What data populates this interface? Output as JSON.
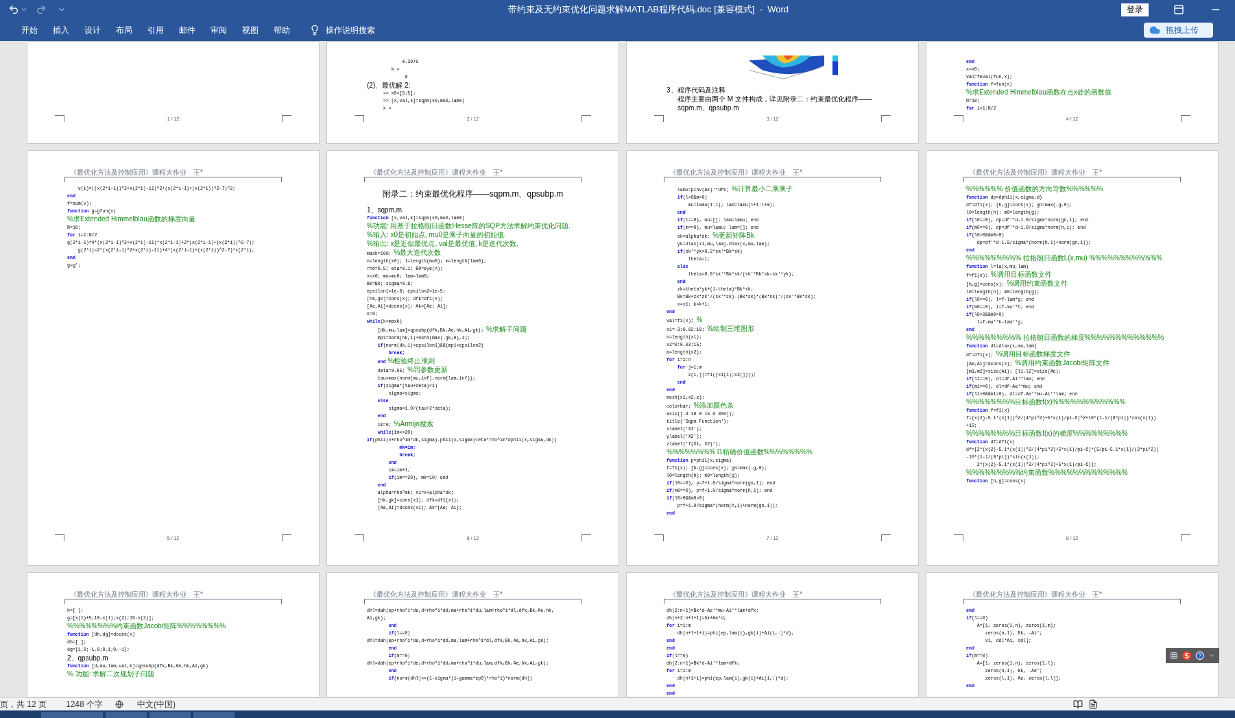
{
  "window": {
    "title": "带约束及无约束优化问题求解MATLAB程序代码.doc [兼容模式]  -  Word",
    "sign_in": "登录"
  },
  "ribbon": {
    "tabs": [
      "开始",
      "插入",
      "设计",
      "布局",
      "引用",
      "邮件",
      "审阅",
      "视图",
      "帮助"
    ],
    "search": "操作说明搜索",
    "upload_button": "拖拽上传"
  },
  "pages": [
    {
      "page_number": "1 / 12"
    },
    {
      "page_number": "2 / 12",
      "lines": [
        {
          "text": "             0.3979"
        },
        {
          "text": "         k ="
        },
        {
          "text": "              8"
        },
        {
          "kind": "heading",
          "text": "(2)、最优解 2:"
        },
        {
          "text": "      >> x0=[5;5];"
        },
        {
          "text": "      >> [x,val,k]=sqpm(x0,mu0,lam0)"
        },
        {
          "text": "      x ="
        }
      ]
    },
    {
      "page_number": "3 / 12",
      "lines": [
        {
          "kind": "heading",
          "text": "3、程序代码及注释"
        },
        {
          "kind": "paragraph",
          "text": "程序主要由两个 M 文件构成，详见附录二：约束最优化程序——sqpm.m、qpsubp.m"
        }
      ]
    },
    {
      "page_number": "4 / 12",
      "lines": [
        {
          "keyword": "end"
        },
        {
          "text": "x=x0;"
        },
        {
          "text": "val=feval(fun,x);"
        },
        {
          "keyword": "function",
          "text": " f=fun(x)"
        },
        {
          "comment": "%求Extended Himmelblau函数在点x处的函数值"
        },
        {
          "text": "N=10;"
        },
        {
          "keyword": "for",
          "text": " i=1:N/2"
        }
      ]
    },
    {
      "header": "《最优化方法及控制应用》课程大作业　王*",
      "page_number": "5 / 12",
      "lines": [
        {
          "text": "    v(i)=((x(2*i-1))^2+x(2*i)-11)^2+(x(2*i-1)+(x(2*i))^2-7)^2;"
        },
        {
          "keyword": "end"
        },
        {
          "text": "f=sum(v);"
        },
        {
          "keyword": "function",
          "text": " g=gfun(x)"
        },
        {
          "comment": "%求Extended Himmelblau函数的梯度向量"
        },
        {
          "text": "N=10;"
        },
        {
          "keyword": "for",
          "text": " i=1:N/2"
        },
        {
          "text": "g(2*i-1)=4*(x(2*i-1)^2+x(2*i)-11)*x(2*i-1)+2*(x(2*i-1)+(x(2*i))^2-7);"
        },
        {
          "text": "    g(2*i)=2*(x(2*i-1)^2+x(2*i)-11)+4*(x(2*i-1)+(x(2*i))^2-7)*x(2*i);"
        },
        {
          "keyword": "end"
        },
        {
          "text": "g=g';"
        }
      ]
    },
    {
      "header": "《最优化方法及控制应用》课程大作业　王*",
      "title": "附录二：约束最优化程序——sqpm.m、qpsubp.m",
      "page_number": "6 / 12",
      "lines": [
        {
          "kind": "heading",
          "text": "1、sqpm.m"
        },
        {
          "keyword": "function",
          "text": " [x,val,k]=sqpm(x0,mu0,lam0)"
        },
        {
          "comment": "%功能: 用基于拉格朗日函数Hesse阵的SQP方法求解约束优化问题."
        },
        {
          "comment": "%输入: x0是初始点, mu0是乘子向量的初始值."
        },
        {
          "comment": "%输出: x是近似最优点, val是最优值, k是迭代次数."
        },
        {
          "text": "maxk=100; ",
          "comment": "%最大迭代次数"
        },
        {
          "text": "n=length(x0); l=length(mu0); m=length(lam0);"
        },
        {
          "text": "rho=0.5; eta=0.1; B0=eye(n);"
        },
        {
          "text": "x=x0; mu=mu0; lam=lam0;"
        },
        {
          "text": "Bk=B0; sigma=0.8;"
        },
        {
          "text": "epsilon1=1e-6; epsilon2=1e-5;"
        },
        {
          "text": "[hk,gk]=cons(x); dfk=df1(x);"
        },
        {
          "text": "[Ae,Ai]=dcons(x); Ak=[Ae; Ai];"
        },
        {
          "text": "k=0;"
        },
        {
          "keyword": "while",
          "text": "(k<maxk)"
        },
        {
          "text": "    [dk,mu,lam]=qpsubp(dfk,Bk,Ae,hk,Ai,gk); ",
          "comment": "%求解子问题"
        },
        {
          "text": "    mp1=norm(hk,1)+norm(max(-gk,0),1);"
        },
        {
          "keyword": "    if",
          "text": "(norm(dk,1)<epsilon1)&&(mp1<epsilon2)"
        },
        {
          "keyword": "        break;"
        },
        {
          "keyword": "    end",
          "comment": " %检验终止准则"
        },
        {
          "text": "    deta=0.05; ",
          "comment": "%罚参数更新"
        },
        {
          "text": "    tau=max(norm(mu,inf),norm(lam,inf));"
        },
        {
          "keyword": "    if",
          "text": "(sigma*(tau+deta)<1)"
        },
        {
          "text": "        sigma=sigma;"
        },
        {
          "keyword": "    else"
        },
        {
          "text": "        sigma=1.0/(tau+2*deta);"
        },
        {
          "keyword": "    end"
        },
        {
          "text": "    im=0; ",
          "comment": "%Armijo搜索"
        },
        {
          "keyword": "    while",
          "text": "(im<=20)"
        },
        {
          "keyword": "if",
          "text": "(phi1(x+rho^im*dk,sigma)-phi1(x,sigma)<eta*rho^im*dphi1(x,sigma,dk))"
        },
        {
          "keyword": "            mk=im;"
        },
        {
          "keyword": "            break;"
        },
        {
          "keyword": "        end"
        },
        {
          "text": "        im=im+1;"
        },
        {
          "keyword": "        if",
          "text": "(im==20), mk=10; end"
        },
        {
          "keyword": "    end"
        },
        {
          "text": "    alpha=rho^mk; x1=x+alpha*dk;"
        },
        {
          "text": "    [hk,gk]=cons(x1); dfk=df1(x1);"
        },
        {
          "text": "    [Ae,Ai]=dcons(x1); Ak=[Ae; Ai];"
        }
      ]
    },
    {
      "header": "《最优化方法及控制应用》课程大作业　王*",
      "page_number": "7 / 12",
      "lines": [
        {
          "text": "    lamu=pinv(Ak)'*dfk; ",
          "comment": "%计算最小二乘乘子"
        },
        {
          "keyword": "    if",
          "text": "(l>0&m>0)"
        },
        {
          "text": "        mu=lamu(1:l); lam=lamu(l+1:l+m);"
        },
        {
          "keyword": "    end"
        },
        {
          "keyword": "    if",
          "text": "(l==0), mu=[]; lam=lamu; end"
        },
        {
          "keyword": "    if",
          "text": "(m==0), mu=lamu; lam=[]; end"
        },
        {
          "text": "    sk=alpha*dk; ",
          "comment": "%更新矩阵Bk"
        },
        {
          "text": "    yk=dlax(x1,mu,lam)-dlax(x,mu,lam);"
        },
        {
          "keyword": "    if",
          "text": "(sk'*yk>0.2*sk'*Bk*sk)"
        },
        {
          "text": "        theta=1;"
        },
        {
          "keyword": "    else"
        },
        {
          "text": "        theta=0.8*sk'*Bk*sk/(sk'*Bk*sk-sk'*yk);"
        },
        {
          "keyword": "    end"
        },
        {
          "text": "    zk=theta*yk+(1-theta)*Bk*sk;"
        },
        {
          "text": "    Bk=Bk+zk*zk'/(sk'*zk)-(Bk*sk)*(Bk*sk)'/(sk'*Bk*sk);"
        },
        {
          "text": "    x=x1; k=k+1;"
        },
        {
          "keyword": "end"
        },
        {
          "text": "val=f1(x); ",
          "comment": "%"
        },
        {
          "text": "x1=-3:0.02:10; ",
          "comment": "%绘制三维图形"
        },
        {
          "text": "n=length(x1);"
        },
        {
          "text": "x2=0:0.02:15;"
        },
        {
          "text": "m=length(x2);"
        },
        {
          "keyword": "for",
          "text": " i=1:n"
        },
        {
          "keyword": "    for",
          "text": " j=1:m"
        },
        {
          "text": "        z(i,j)=f1([x1(i);x2(j)]);"
        },
        {
          "keyword": "    end"
        },
        {
          "keyword": "end"
        },
        {
          "text": "mesh(x1,x2,z);"
        },
        {
          "text": "colorbar; ",
          "comment": "%添加颜色条"
        },
        {
          "text": "axis([-3 10 0 15 0 350]);"
        },
        {
          "text": "title('Sqpm Function');"
        },
        {
          "text": "xlabel('X1');"
        },
        {
          "text": "ylabel('X2');"
        },
        {
          "text": "zlabel('f(X1, X2)');"
        },
        {
          "comment": "%%%%%%%% l1精确价值函数%%%%%%%%"
        },
        {
          "keyword": "function",
          "text": " p=phi1(x,sigma)"
        },
        {
          "text": "f=f1(x); [h,g]=cons(x); gn=max(-g,0);"
        },
        {
          "text": "l0=length(h); m0=length(g);"
        },
        {
          "keyword": "if",
          "text": "(l0==0), p=f+1.0/sigma*norm(gn,1); end"
        },
        {
          "keyword": "if",
          "text": "(m0==0), p=f+1.0/sigma*norm(h,1); end"
        },
        {
          "keyword": "if",
          "text": "(l0>0&&m0>0)"
        },
        {
          "text": "    p=f+1.0/sigma*(norm(h,1)+norm(gn,1));"
        },
        {
          "keyword": "end"
        }
      ]
    },
    {
      "header": "《最优化方法及控制应用》课程大作业　王*",
      "page_number": "8 / 12",
      "lines": [
        {
          "comment": "%%%%%% 价值函数的方向导数%%%%%%"
        },
        {
          "keyword": "function",
          "text": " dp=dphi1(x,sigma,d)"
        },
        {
          "text": "df=df1(x); [h,g]=cons(x); gn=max(-g,0);"
        },
        {
          "text": "l0=length(h); m0=length(g);"
        },
        {
          "keyword": "if",
          "text": "(l0==0), dp=df'*d-1.0/sigma*norm(gn,1); end"
        },
        {
          "keyword": "if",
          "text": "(m0==0), dp=df'*d-1.0/sigma*norm(h,1); end"
        },
        {
          "keyword": "if",
          "text": "(l0>0&&m0>0)"
        },
        {
          "text": "    dp=df'*d-1.0/sigma*(norm(h,1)+norm(gn,1));"
        },
        {
          "keyword": "end"
        },
        {
          "comment": "%%%%%%%%% 拉格朗日函数L(x,mu) %%%%%%%%%%%%"
        },
        {
          "keyword": "function",
          "text": " l=la(x,mu,lam)"
        },
        {
          "text": "f=f1(x); ",
          "comment": "%调用目标函数文件"
        },
        {
          "text": "[h,g]=cons(x); ",
          "comment": "%调用约束函数文件"
        },
        {
          "text": "l0=length(h); m0=length(g);"
        },
        {
          "keyword": "if",
          "text": "(l0==0), l=f-lam*g; end"
        },
        {
          "keyword": "if",
          "text": "(m0==0), l=f-mu'*h; end"
        },
        {
          "keyword": "if",
          "text": "(l0>0&&m0>0)"
        },
        {
          "text": "    l=f-mu'*h-lam'*g;"
        },
        {
          "keyword": "end"
        },
        {
          "comment": "%%%%%%%%% 拉格朗日函数的梯度%%%%%%%%%%%%%"
        },
        {
          "keyword": "function",
          "text": " dl=dlax(x,mu,lam)"
        },
        {
          "text": "df=df1(x); ",
          "comment": "%调用目标函数梯度文件"
        },
        {
          "text": "[Ae,Ai]=dcons(x); ",
          "comment": "%调用约束函数Jacobi矩阵文件"
        },
        {
          "text": "[m1,m2]=size(Ai); [l1,l2]=size(Ae);"
        },
        {
          "keyword": "if",
          "text": "(l1==0), dl=df-Ai'*lam; end"
        },
        {
          "keyword": "if",
          "text": "(m1==0), dl=df-Ae'*mu; end"
        },
        {
          "keyword": "if",
          "text": "(l1>0&&m1>0), dl=df-Ae'*mu-Ai'*lam; end"
        },
        {
          "comment": "%%%%%%%%目标函数f(x)%%%%%%%%%%%%"
        },
        {
          "keyword": "function",
          "text": " f=f1(x)"
        },
        {
          "text": "f=(x(2)-5.1*(x(1))^2/(4*pi^2)+5*x(1)/pi-6)^2+10*(1-1/(8*pi))*cos(x(1))"
        },
        {
          "text": "+10;"
        },
        {
          "comment": "%%%%%%%%目标函数f(x)的梯度%%%%%%%%%"
        },
        {
          "keyword": "function",
          "text": " df=df1(x)"
        },
        {
          "text": "df=[2*(x(2)-5.1*(x(1))^2/(4*pi^2)+5*x(1)/pi-6)*(5/pi-5.1*x(1)/(2*pi^2))"
        },
        {
          "text": "-10*(1-1/(8*pi))*sin(x(1));"
        },
        {
          "text": "    2*(x(2)-5.1*(x(1))^2/(4*pi^2)+5*x(1)/pi-6)];"
        },
        {
          "comment": "%%%%%%%%%约束函数%%%%%%%%%%%%%"
        },
        {
          "keyword": "function",
          "text": " [h,g]=cons(x)"
        }
      ]
    },
    {
      "header": "《最优化方法及控制应用》课程大作业　王*",
      "lines": [
        {
          "text": "h=[ ];"
        },
        {
          "text": "g=[x(1)+5;10-x(1);x(2);15-x(2)];"
        },
        {
          "comment": "%%%%%%%%约束函数Jacobi矩阵%%%%%%%%"
        },
        {
          "keyword": "function",
          "text": " [dh,dg]=dcons(x)"
        },
        {
          "text": "dh=[ ];"
        },
        {
          "text": "dg=[1,0;-1,0;0,1;0,-1];"
        },
        {
          "kind": "heading",
          "text": "2、qpsubp.m"
        },
        {
          "keyword": "function",
          "text": " [d,mu,lam,val,k]=qpsubp(dfk,Bk,Ae,hk,Ai,gk)"
        },
        {
          "comment": "% 功能: 求解二次规划子问题"
        }
      ]
    },
    {
      "header": "《最优化方法及控制应用》课程大作业　王*",
      "lines": [
        {
          "text": "dhl=dah(ep+rho^i*de,d+rho^i*dd,mu+rho^i*du,lam+rho^i*dl,dfk,Bk,Ae,hk,"
        },
        {
          "text": "Ai,gk);"
        },
        {
          "keyword": "        end"
        },
        {
          "keyword": "        if",
          "text": "(l==0)"
        },
        {
          "text": "dhl=dah(ep+rho^i*de,d+rho^i*dd,mu,lam+rho^i*dl,dfk,Bk,Ae,hk,Ai,gk);"
        },
        {
          "keyword": "        end"
        },
        {
          "keyword": "        if",
          "text": "(m==0)"
        },
        {
          "text": "dhl=dah(ep+rho^i*de,d+rho^i*dd,mu+rho^i*du,lam,dfk,Bk,Ae,hk,Ai,gk);"
        },
        {
          "keyword": "        end"
        },
        {
          "keyword": "        if",
          "text": "(norm(dhl)<=(1-sigma*(1-gamma*ep0)*rho^i)*norm(dh))"
        }
      ]
    },
    {
      "header": "《最优化方法及控制应用》课程大作业　王*",
      "lines": [
        {
          "text": "dh(2:n+1)=Bk*d-Ae'*mu-Ai'*lam+dfk;"
        },
        {
          "text": "dh(n+2:n+l+1)=hk+Ae*d;"
        },
        {
          "keyword": "for",
          "text": " i=1:m"
        },
        {
          "text": "    dh(n+l+1+i)=phi(ep,lam(i),gk(i)+Ai(i,:)*d);"
        },
        {
          "keyword": "end"
        },
        {
          "keyword": "end"
        },
        {
          "keyword": "if",
          "text": "(l==0)"
        },
        {
          "text": "dh(2:n+1)=Bk*d-Ai'*lam+dfk;"
        },
        {
          "keyword": "for",
          "text": " i=1:m"
        },
        {
          "text": "    dh(n+1+i)=phi(ep,lam(i),gk(i)+Ai(i,:)*d);"
        },
        {
          "keyword": "end"
        },
        {
          "keyword": "end"
        }
      ]
    },
    {
      "header": "《最优化方法及控制应用》课程大作业　王*",
      "lines": [
        {
          "keyword": "end"
        },
        {
          "keyword": "if",
          "text": "(l==0)"
        },
        {
          "text": "    A=[1, zeros(1,n), zeros(1,m);"
        },
        {
          "text": "       zeros(n,1), Bk, -Ai';"
        },
        {
          "text": "       v1, ddl*Ai, ddl];"
        },
        {
          "keyword": "end"
        },
        {
          "keyword": "if",
          "text": "(m==0)"
        },
        {
          "text": "    A=[1, zeros(1,n), zeros(1,l);"
        },
        {
          "text": "       zeros(n,1), Bk, -Ae';"
        },
        {
          "text": "       zeros(l,1), Ae, zeros(l,l)];"
        },
        {
          "keyword": "end"
        }
      ]
    }
  ],
  "status_bar": {
    "pages": "页，共 12 页",
    "words": "1248 个字",
    "language": "中文(中国)"
  }
}
